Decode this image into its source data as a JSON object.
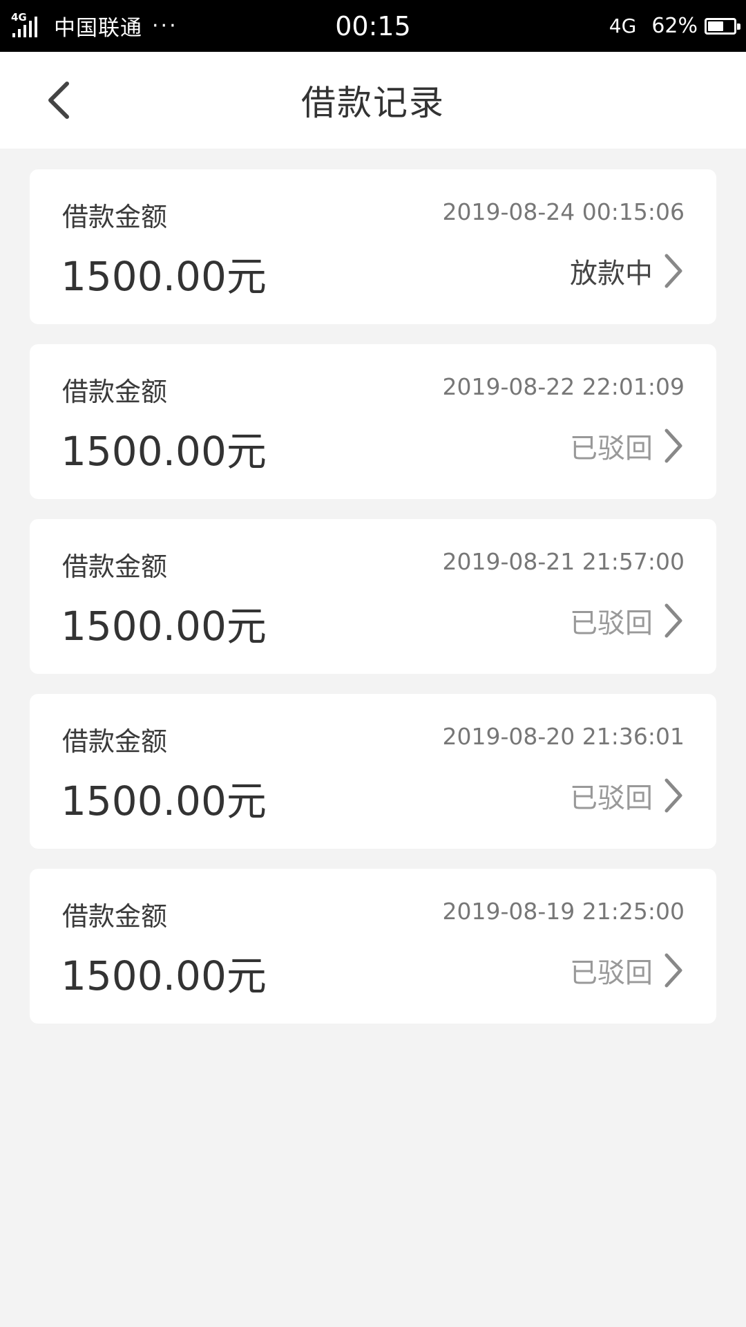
{
  "status_bar": {
    "network_small": "4G",
    "carrier": "中国联通",
    "more": "···",
    "time": "00:15",
    "network": "4G",
    "battery": "62%",
    "battery_level": 0.62
  },
  "header": {
    "title": "借款记录",
    "back_icon": "chevron-left-icon"
  },
  "records": [
    {
      "label": "借款金额",
      "datetime": "2019-08-24 00:15:06",
      "amount": "1500.00元",
      "status": "放款中",
      "active": true
    },
    {
      "label": "借款金额",
      "datetime": "2019-08-22 22:01:09",
      "amount": "1500.00元",
      "status": "已驳回",
      "active": false
    },
    {
      "label": "借款金额",
      "datetime": "2019-08-21 21:57:00",
      "amount": "1500.00元",
      "status": "已驳回",
      "active": false
    },
    {
      "label": "借款金额",
      "datetime": "2019-08-20 21:36:01",
      "amount": "1500.00元",
      "status": "已驳回",
      "active": false
    },
    {
      "label": "借款金额",
      "datetime": "2019-08-19 21:25:00",
      "amount": "1500.00元",
      "status": "已驳回",
      "active": false
    }
  ],
  "colors": {
    "background": "#f3f3f3",
    "card": "#ffffff",
    "status_active": "#444444",
    "status_rejected": "#999999"
  }
}
